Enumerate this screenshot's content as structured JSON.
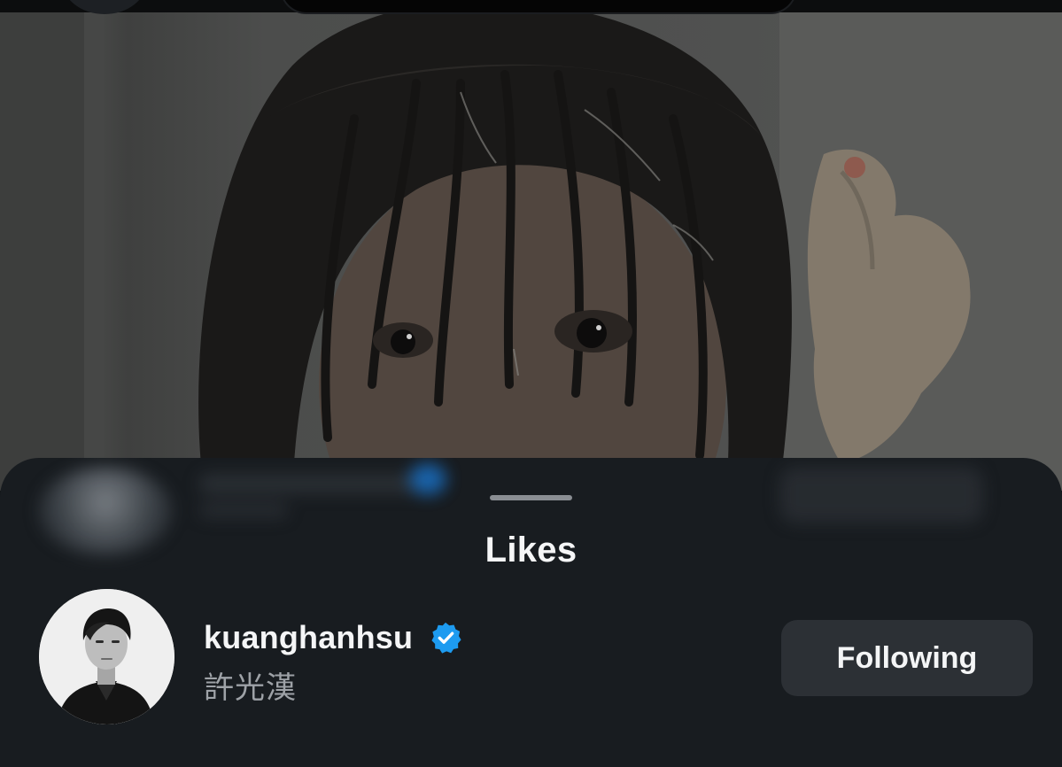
{
  "sheet": {
    "title": "Likes"
  },
  "likes": [
    {
      "username": "kuanghanhsu",
      "display_name": "許光漢",
      "verified": true,
      "follow_status": "Following"
    }
  ],
  "colors": {
    "sheet_background": "#181c20",
    "verified_badge": "#1d9bf0",
    "button_background": "#2c3035",
    "primary_text": "#f4f5f6",
    "secondary_text": "#9ea2a7"
  },
  "icons": {
    "verified": "verified-badge-icon",
    "avatar": "profile-avatar"
  }
}
